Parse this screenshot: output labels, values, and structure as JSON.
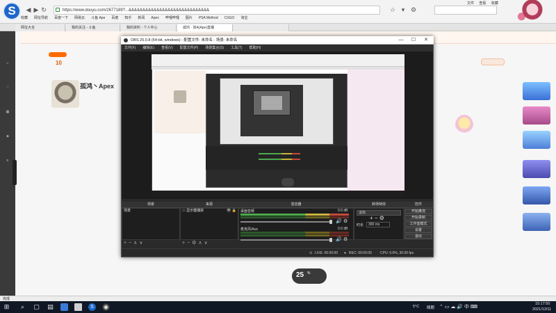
{
  "browser": {
    "address": "https://www.douyu.com/2677189?...&&&&&&&&&&&&&&&&&&&&&&&&&&&&&",
    "search_placeholder": "",
    "top_menu": [
      "文件",
      "查看",
      "收藏"
    ],
    "user": "",
    "bookmarks": [
      "收藏",
      "网址导航",
      "百度一下",
      "网易云",
      "斗鱼 Ape",
      "百度",
      "知乎",
      "新闻",
      "Apex",
      "哔哩哔哩",
      "图片",
      "PSA Method",
      "CSGO",
      "淘宝"
    ]
  },
  "tabs": [
    {
      "label": "网址大全",
      "active": false
    },
    {
      "label": "我的关注 - 斗鱼",
      "active": false
    },
    {
      "label": "我的资料 - 个人中心",
      "active": false
    },
    {
      "label": "孤鸿 · 张A(Ape)直播",
      "active": true
    },
    {
      "label": "",
      "active": false
    }
  ],
  "page": {
    "room_title": "孤鸿丶Apex",
    "follow_count": "10",
    "hot_badge": "",
    "right_tag": "",
    "right_panel_text": "",
    "status": "完成"
  },
  "obs": {
    "title": "OBS 25.0.8 (64-bit, windows) - 配置文件: 未命名 - 场景: 未命名",
    "window_buttons": [
      "—",
      "☐",
      "✕"
    ],
    "menu": [
      "文件(F)",
      "编辑(E)",
      "查看(V)",
      "配置文件(P)",
      "场景集合(S)",
      "工具(T)",
      "帮助(H)"
    ],
    "docks": {
      "scenes": "场景",
      "sources": "来源",
      "mixer": "混音器",
      "transitions": "转场特效",
      "controls": "控件"
    },
    "scene_items": [
      "场景"
    ],
    "source_items": [
      "显示器捕获"
    ],
    "mixer": [
      {
        "label": "桌面音频",
        "db": "0.0 dB"
      },
      {
        "label": "麦克风/Aux",
        "db": "0.0 dB"
      }
    ],
    "transition": {
      "type": "淡出",
      "duration_label": "时长",
      "duration": "300 ms"
    },
    "controls": [
      "开始推流",
      "开始录制",
      "工作室模式",
      "设置",
      "退出"
    ],
    "status": {
      "live": "LIVE: 00:00:00",
      "rec": "REC: 00:00:00",
      "cpu": "CPU: 0.6%, 30.00 fps"
    }
  },
  "widget": {
    "value": "25",
    "unit": "%"
  },
  "taskbar": {
    "temperature": "5°C",
    "weather": "晴朗",
    "time": "15:17:50",
    "date": "2021/12/11"
  },
  "colors": {
    "accent": "#ff6a00",
    "logo": "#1e66c9",
    "obs_bg": "#2a2a2a",
    "meter_green": "#4caa4c",
    "meter_yellow": "#cbb43a",
    "meter_red": "#c64a3b"
  }
}
